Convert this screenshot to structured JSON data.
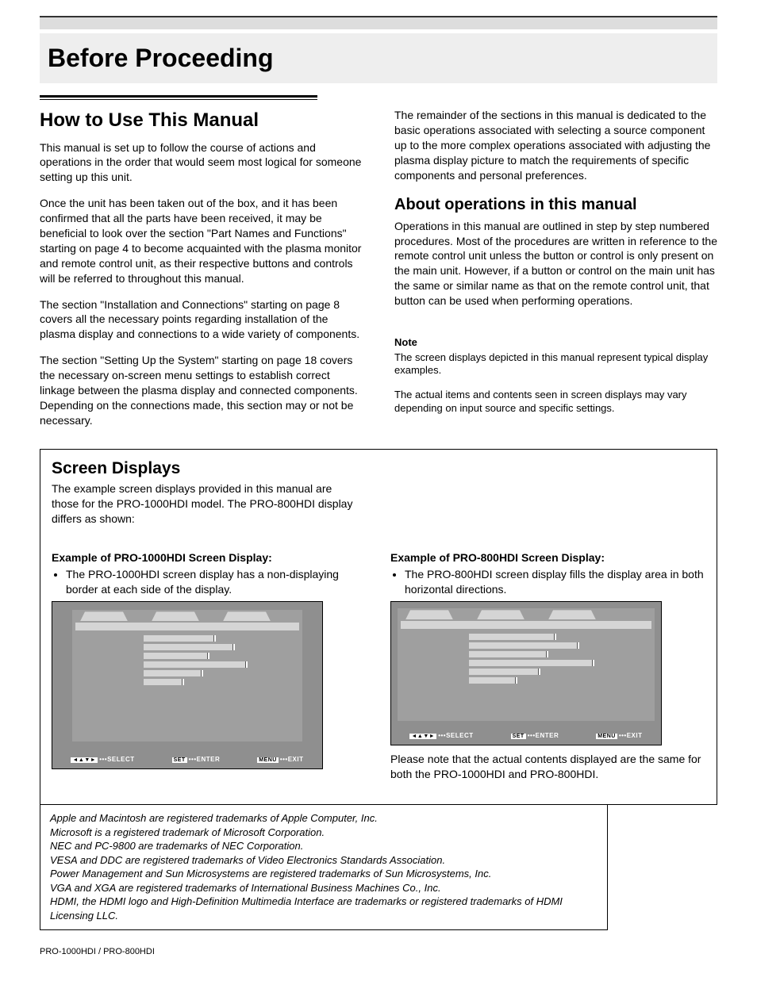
{
  "chapter_title": "Before Proceeding",
  "left": {
    "h2": "How to Use This Manual",
    "p1": "This manual is set up to follow the course of actions and operations in the order that would seem most logical for someone setting up this unit.",
    "p2": "Once the unit has been taken out of the box, and it has been confirmed that all the parts have been received, it may be beneficial to look over the section \"Part Names and Functions\" starting on page 4 to become acquainted with the plasma monitor and remote control unit, as their respective buttons and controls will be referred to throughout this manual.",
    "p3": "The section \"Installation and Connections\" starting on page 8 covers all the necessary points regarding installation of the plasma display and connections to a wide variety of components.",
    "p4": "The section \"Setting Up the System\" starting on page 18 covers the necessary on-screen menu settings to establish correct linkage between the plasma display and connected components. Depending on the connections made, this section may or not be necessary."
  },
  "right": {
    "p1": "The remainder of the sections in this manual is dedicated to the basic operations associated with selecting a source component up to the more complex operations associated with adjusting the plasma display picture to match the requirements of specific components and personal preferences.",
    "h2": "About operations in this manual",
    "p2": "Operations in this manual are outlined in step by step numbered procedures. Most of the procedures are written in reference to the remote control unit unless the button or control is only present on the main unit. However, if a button or control on the main unit has the same or similar name as that on the remote control unit, that button can be used when performing operations.",
    "note_hd": "Note",
    "note1": "The screen displays depicted in this manual represent typical display examples.",
    "note2": "The actual items and contents seen in screen displays may vary depending on input source and specific settings."
  },
  "box": {
    "title": "Screen Displays",
    "intro": "The example screen displays provided in this manual are those for the PRO-1000HDI model. The PRO-800HDI display differs as shown:",
    "left_h": "Example of PRO-1000HDI Screen Display:",
    "left_b": "The PRO-1000HDI screen display has a non-displaying border at each side of the display.",
    "right_h": "Example of PRO-800HDI Screen Display:",
    "right_b": "The PRO-800HDI screen display fills the display area in both horizontal directions.",
    "right_after": "Please note that the actual contents displayed are the same for both the PRO-1000HDI and PRO-800HDI.",
    "footer_select": "SELECT",
    "footer_enter": "ENTER",
    "footer_exit": "EXIT",
    "key_set": "SET",
    "key_menu": "MENU"
  },
  "trademarks": {
    "t1": "Apple and Macintosh are registered trademarks of Apple Computer, Inc.",
    "t2": "Microsoft is a registered trademark of Microsoft Corporation.",
    "t3": "NEC and PC-9800 are trademarks of NEC Corporation.",
    "t4": "VESA and DDC are registered trademarks of Video Electronics Standards Association.",
    "t5": "Power Management and Sun Microsystems are registered trademarks of Sun Microsystems, Inc.",
    "t6": "VGA and XGA are registered trademarks of International Business Machines Co., Inc.",
    "t7": "HDMI, the HDMI logo and High-Definition Multimedia Interface are trademarks or registered trademarks of HDMI Licensing LLC."
  },
  "footer_model": "PRO-1000HDI / PRO-800HDI"
}
